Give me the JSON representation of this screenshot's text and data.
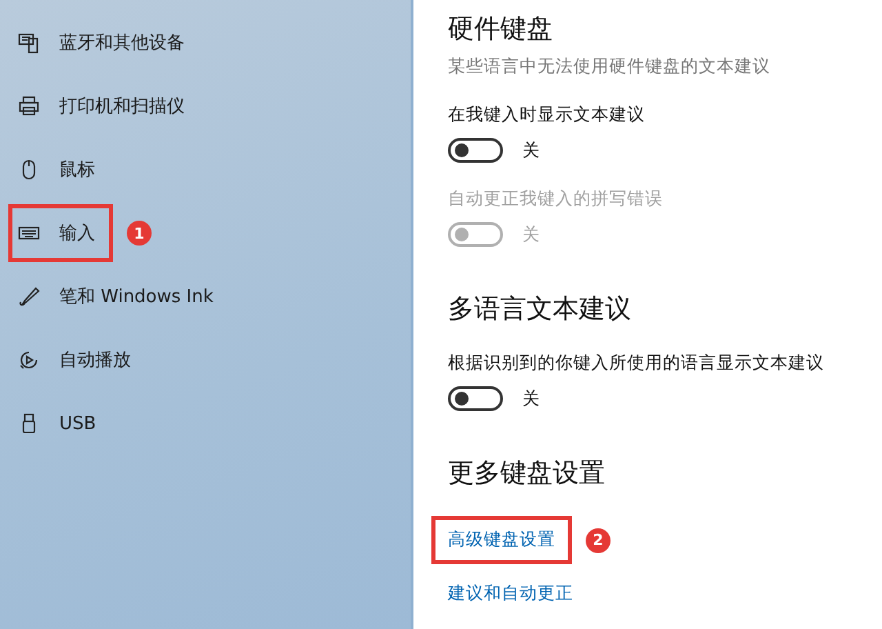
{
  "sidebar": {
    "items": [
      {
        "label": "蓝牙和其他设备",
        "highlighted": false
      },
      {
        "label": "打印机和扫描仪",
        "highlighted": false
      },
      {
        "label": "鼠标",
        "highlighted": false
      },
      {
        "label": "输入",
        "highlighted": true,
        "callout": "1"
      },
      {
        "label": "笔和 Windows Ink",
        "highlighted": false
      },
      {
        "label": "自动播放",
        "highlighted": false
      },
      {
        "label": "USB",
        "highlighted": false
      }
    ]
  },
  "sections": [
    {
      "heading": "硬件键盘",
      "description": "某些语言中无法使用硬件键盘的文本建议",
      "settings": [
        {
          "label": "在我键入时显示文本建议",
          "on": false,
          "disabled": false,
          "state_text": "关"
        },
        {
          "label": "自动更正我键入的拼写错误",
          "on": false,
          "disabled": true,
          "state_text": "关"
        }
      ]
    },
    {
      "heading": "多语言文本建议",
      "settings": [
        {
          "label": "根据识别到的你键入所使用的语言显示文本建议",
          "on": false,
          "disabled": false,
          "state_text": "关"
        }
      ]
    },
    {
      "heading": "更多键盘设置",
      "links": [
        {
          "label": "高级键盘设置",
          "highlighted": true,
          "callout": "2"
        },
        {
          "label": "建议和自动更正",
          "highlighted": false
        }
      ]
    }
  ]
}
